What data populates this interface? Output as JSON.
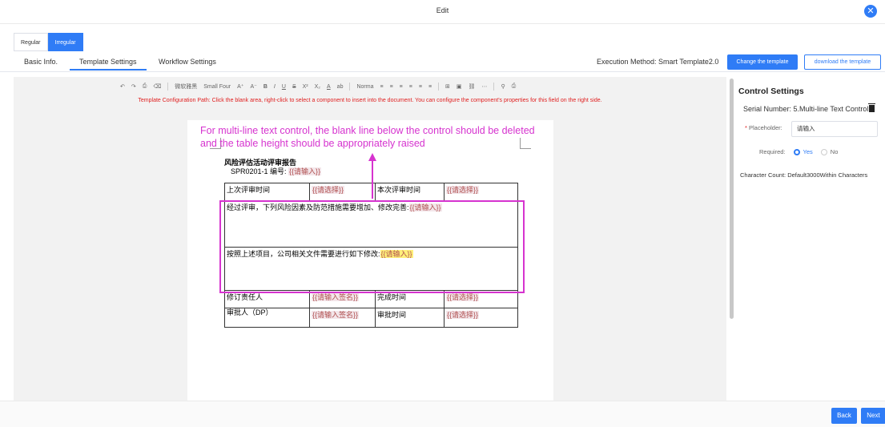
{
  "dialog": {
    "title": "Edit",
    "close_icon": "✕"
  },
  "mode_tabs": [
    {
      "label": "Regular",
      "active": false
    },
    {
      "label": "Irregular",
      "active": true
    }
  ],
  "nav_tabs": [
    {
      "label": "Basic Info."
    },
    {
      "label": "Template Settings",
      "active": true
    },
    {
      "label": "Workflow Settings"
    }
  ],
  "execution": {
    "label": "Execution Method: Smart Template2.0",
    "change_button": "Change the template",
    "download_button": "download the template"
  },
  "toolbar": {
    "undo": "↶",
    "redo": "↷",
    "print": "⎙",
    "eraser": "⌫",
    "font_family": "微软雅黑",
    "font_size": "Small Four",
    "grow": "A⁺",
    "shrink": "A⁻",
    "bold": "B",
    "italic": "I",
    "underline": "U",
    "strike": "S",
    "superscript": "X²",
    "subscript": "X₂",
    "font_color": "A",
    "highlight": "ab",
    "paragraph": "Norma",
    "align": "≡",
    "table": "⊞",
    "image": "▣",
    "link": "⛓",
    "more": "⋯",
    "search": "⚲",
    "print2": "⎙"
  },
  "config_path": "Template Configuration Path: Click the blank area, right-click to select a component to insert into the document. You can configure the component's properties for this field on the right side.",
  "annotation": {
    "line1": "For multi-line text control, the blank line below the control should be deleted",
    "line2": "and the table height should be appropriately raised"
  },
  "document": {
    "title": "风险评估活动评审报告",
    "code": "SPR0201-1  编号:",
    "code_ph": "{{请输入}}",
    "rows": {
      "r1": {
        "c1": "上次评审时间",
        "c2": "{{请选择}}",
        "c3": "本次评审时间",
        "c4": "{{请选择}}"
      },
      "r2": {
        "text": "经过评审，下列风险因素及防范措施需要增加、修改完善:",
        "ph": "{{请输入}}"
      },
      "r3": {
        "text": "按照上述项目，公司相关文件需要进行如下修改:",
        "ph": "{{请输入}}"
      },
      "r4": {
        "c1": "修订责任人",
        "c2": "{{请输入签名}}",
        "c3": "完成时间",
        "c4": "{{请选择}}"
      },
      "r5": {
        "c1": "审批人（DP）",
        "c2": "{{请输入签名}}",
        "c3": "审批时间",
        "c4": "{{请选择}}"
      }
    }
  },
  "control_settings": {
    "title": "Control Settings",
    "serial": "Serial Number: 5.Multi-line Text Control",
    "placeholder_label": "Placeholder:",
    "placeholder_value": "请输入",
    "required_label": "Required:",
    "yes": "Yes",
    "no": "No",
    "character_count": "Character Count:  Default3000Within Characters"
  },
  "footer": {
    "back": "Back",
    "next": "Next"
  },
  "colors": {
    "accent": "#2f7cf6",
    "annotation": "#d633cf",
    "warning": "#e02020"
  }
}
